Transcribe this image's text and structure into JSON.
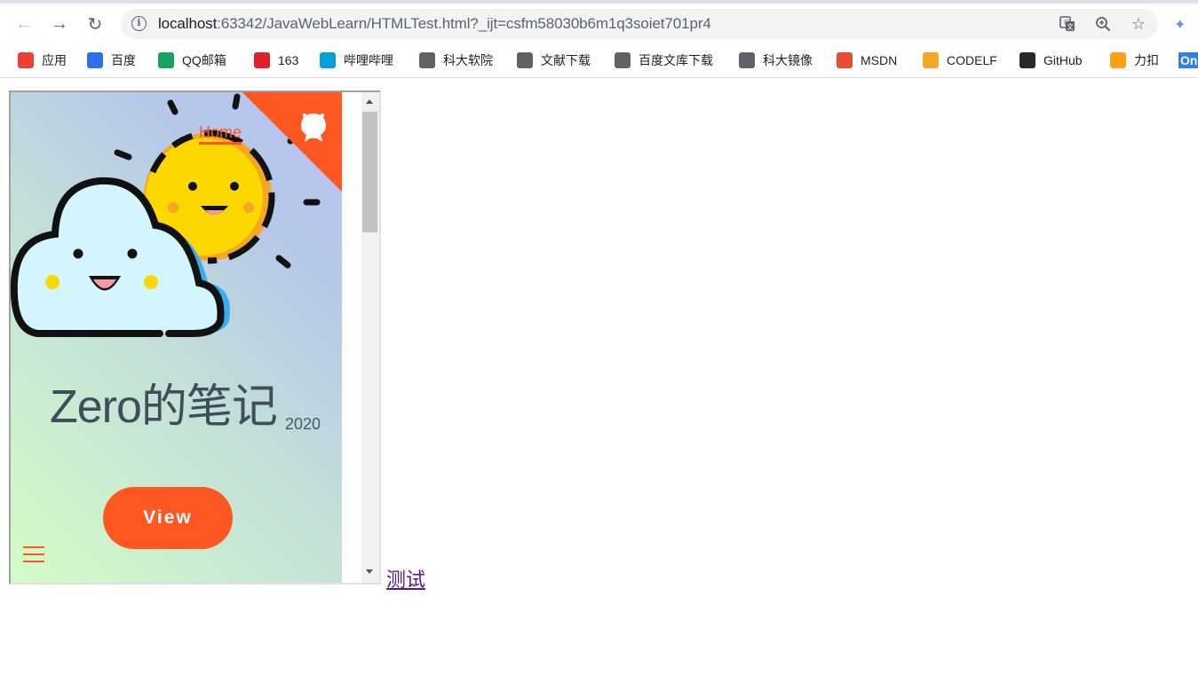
{
  "browser": {
    "url_host": "localhost",
    "url_rest": ":63342/JavaWebLearn/HTMLTest.html?_ijt=csfm58030b6m1q3soiet701pr4",
    "icons": {
      "back": "back-arrow-icon",
      "forward": "forward-arrow-icon",
      "reload": "reload-icon",
      "info": "info-icon",
      "translate": "translate-icon",
      "zoom": "zoom-icon",
      "star": "star-icon",
      "extension": "extension-icon"
    }
  },
  "bookmarks": [
    {
      "label": "应用",
      "color": "#ea4335"
    },
    {
      "label": "百度",
      "color": "#2f6fec"
    },
    {
      "label": "QQ邮箱",
      "color": "#1aa260"
    },
    {
      "label": "163",
      "color": "#e0202a"
    },
    {
      "label": "哔哩哔哩",
      "color": "#00a1d6"
    },
    {
      "label": "科大软院",
      "color": "#5f6368"
    },
    {
      "label": "文献下载",
      "color": "#5f6368"
    },
    {
      "label": "百度文库下载",
      "color": "#5f6368"
    },
    {
      "label": "科大镜像",
      "color": "#5f6368"
    },
    {
      "label": "MSDN",
      "color": "#e94b35"
    },
    {
      "label": "CODELF",
      "color": "#f5a623"
    },
    {
      "label": "GitHub",
      "color": "#24292e"
    },
    {
      "label": "力扣",
      "color": "#ffa116"
    },
    {
      "label": "On",
      "color": "#2f80ed"
    }
  ],
  "iframe": {
    "nav_home": "Home",
    "title": "Zero的笔记",
    "year": "2020",
    "view_button": "View",
    "accent": "#ff5722"
  },
  "test_link": "测试"
}
